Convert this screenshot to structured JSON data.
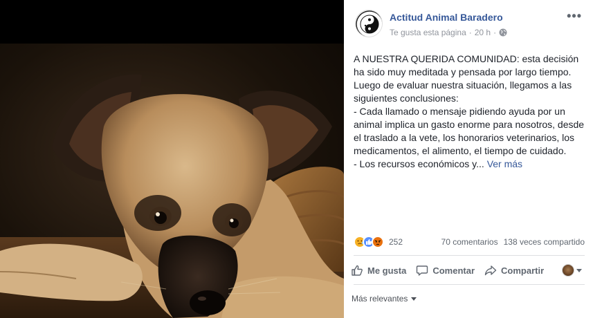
{
  "post": {
    "page_name": "Actitud Animal Baradero",
    "like_page_label": "Te gusta esta página",
    "separator": "·",
    "time": "20 h",
    "privacy_icon": "globe-icon",
    "more_options_label": "•••",
    "text": "A NUESTRA QUERIDA COMUNIDAD: esta decisión ha sido muy meditada y pensada por largo tiempo. Luego de evaluar nuestra situación, llegamos a las siguientes conclusiones:\n- Cada llamado o mensaje pidiendo ayuda por un animal implica un gasto enorme para nosotros, desde el traslado a la vete, los honorarios veterinarios, los medicamentos, el alimento, el tiempo de cuidado.\n- Los recursos económicos y...",
    "see_more_label": "Ver más"
  },
  "stats": {
    "reaction_icons": [
      "sad-reaction-icon",
      "like-reaction-icon",
      "angry-reaction-icon"
    ],
    "reaction_count": "252",
    "comments": "70 comentarios",
    "shares": "138 veces compartido"
  },
  "actions": {
    "like_label": "Me gusta",
    "comment_label": "Comentar",
    "share_label": "Compartir"
  },
  "comments": {
    "sort_label": "Más relevantes"
  },
  "colors": {
    "link_blue": "#365899",
    "meta_gray": "#90949c",
    "action_gray": "#606770",
    "text": "#1d2129",
    "divider": "#dddfe2"
  }
}
